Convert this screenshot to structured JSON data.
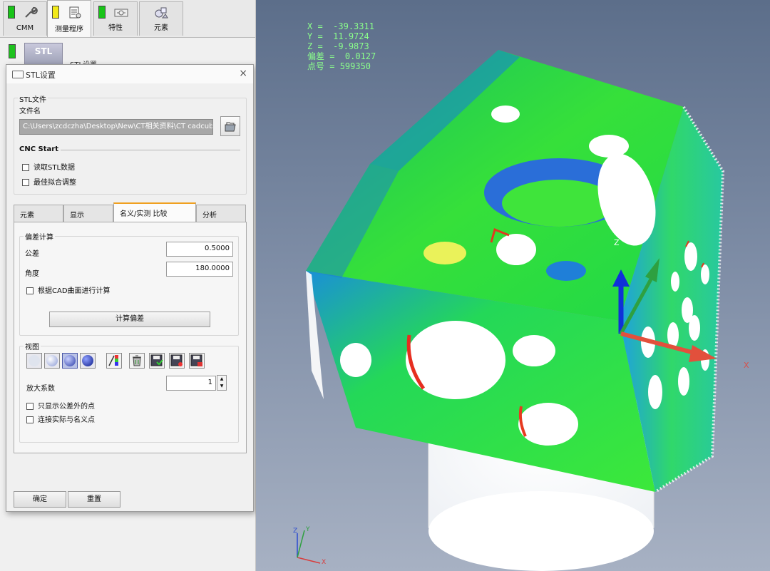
{
  "top_tabs": [
    {
      "label": "CMM",
      "status_color": "#18c418",
      "active": false,
      "icon": "wrench-icon"
    },
    {
      "label": "测量程序",
      "status_color": "#f2ea1a",
      "active": true,
      "icon": "document-icon"
    },
    {
      "label": "特性",
      "status_color": "#18c418",
      "active": false,
      "icon": "feature-icon"
    },
    {
      "label": "元素",
      "status_color": null,
      "active": false,
      "icon": "elements-icon"
    }
  ],
  "subrow": {
    "thumb_text": "STL",
    "label": "STL设置"
  },
  "dialog": {
    "title": "STL设置",
    "close": "×",
    "stl_file_group": "STL文件",
    "filename_label": "文件名",
    "filepath": "C:\\Users\\zcdczha\\Desktop\\New\\CT相关资料\\CT cadcube\\IM",
    "cnc_start_label": "CNC Start",
    "read_stl_label": "读取STL数据",
    "best_fit_label": "最佳拟合调整",
    "tabs": [
      "元素",
      "显示",
      "名义/实测 比较",
      "分析"
    ],
    "active_tab": 2,
    "deviation_group": "偏差计算",
    "tolerance_label": "公差",
    "tolerance_value": "0.5000",
    "angle_label": "角度",
    "angle_value": "180.0000",
    "cad_surface_label": "根据CAD曲面进行计算",
    "calc_button": "计算偏差",
    "view_group": "视图",
    "magnify_label": "放大系数",
    "magnify_value": "1",
    "only_out_tol_label": "只显示公差外的点",
    "connect_label": "连接实际与名义点",
    "ok_button": "确定",
    "reset_button": "重置"
  },
  "viewport": {
    "readout": {
      "x_label": "X =",
      "x_value": "-39.3311",
      "y_label": "Y =",
      "y_value": "11.9724",
      "z_label": "Z =",
      "z_value": "-9.9873",
      "dev_label": "偏差 =",
      "dev_value": "0.0127",
      "pt_label": "点号 =",
      "pt_value": "599350"
    },
    "axis_z": "Z",
    "axis_x": "X",
    "mini_x": "X",
    "mini_y": "Y",
    "mini_z": "Z"
  },
  "colors": {
    "readout": "#8bff8b",
    "green_led": "#18c418",
    "yellow_led": "#f2ea1a",
    "active_tab_accent": "#f0a020"
  }
}
